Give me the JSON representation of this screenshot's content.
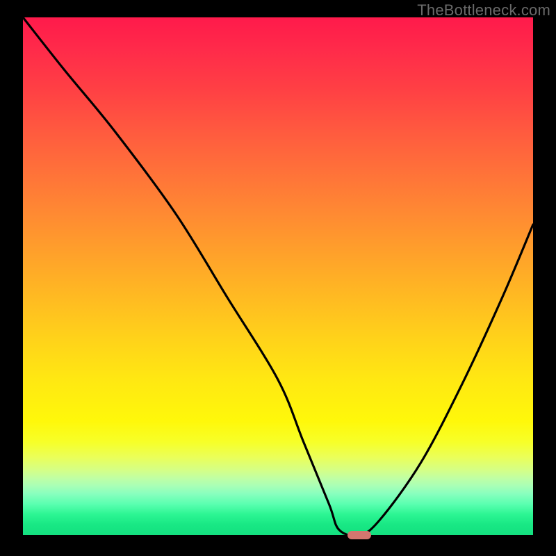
{
  "watermark": "TheBottleneck.com",
  "colors": {
    "frame_bg": "#000000",
    "curve_stroke": "#000000",
    "marker_fill": "#d4766f",
    "watermark_text": "#6a6a6a"
  },
  "chart_data": {
    "type": "line",
    "title": "",
    "xlabel": "",
    "ylabel": "",
    "xlim": [
      0,
      100
    ],
    "ylim": [
      0,
      100
    ],
    "series": [
      {
        "name": "bottleneck-curve",
        "x": [
          0,
          8,
          18,
          30,
          40,
          50,
          55,
          60,
          62,
          66,
          70,
          78,
          86,
          94,
          100
        ],
        "values": [
          100,
          90,
          78,
          62,
          46,
          30,
          18,
          6,
          1,
          0,
          3,
          14,
          29,
          46,
          60
        ]
      }
    ],
    "annotations": [
      {
        "name": "optimal-marker",
        "x": 66,
        "y": 0
      }
    ],
    "background_gradient": {
      "direction": "vertical",
      "stops": [
        {
          "pos": 0.0,
          "color": "#ff1a4b"
        },
        {
          "pos": 0.5,
          "color": "#ffba22"
        },
        {
          "pos": 0.8,
          "color": "#fff80a"
        },
        {
          "pos": 1.0,
          "color": "#14e080"
        }
      ],
      "meaning": "red=high bottleneck, green=low bottleneck"
    }
  }
}
